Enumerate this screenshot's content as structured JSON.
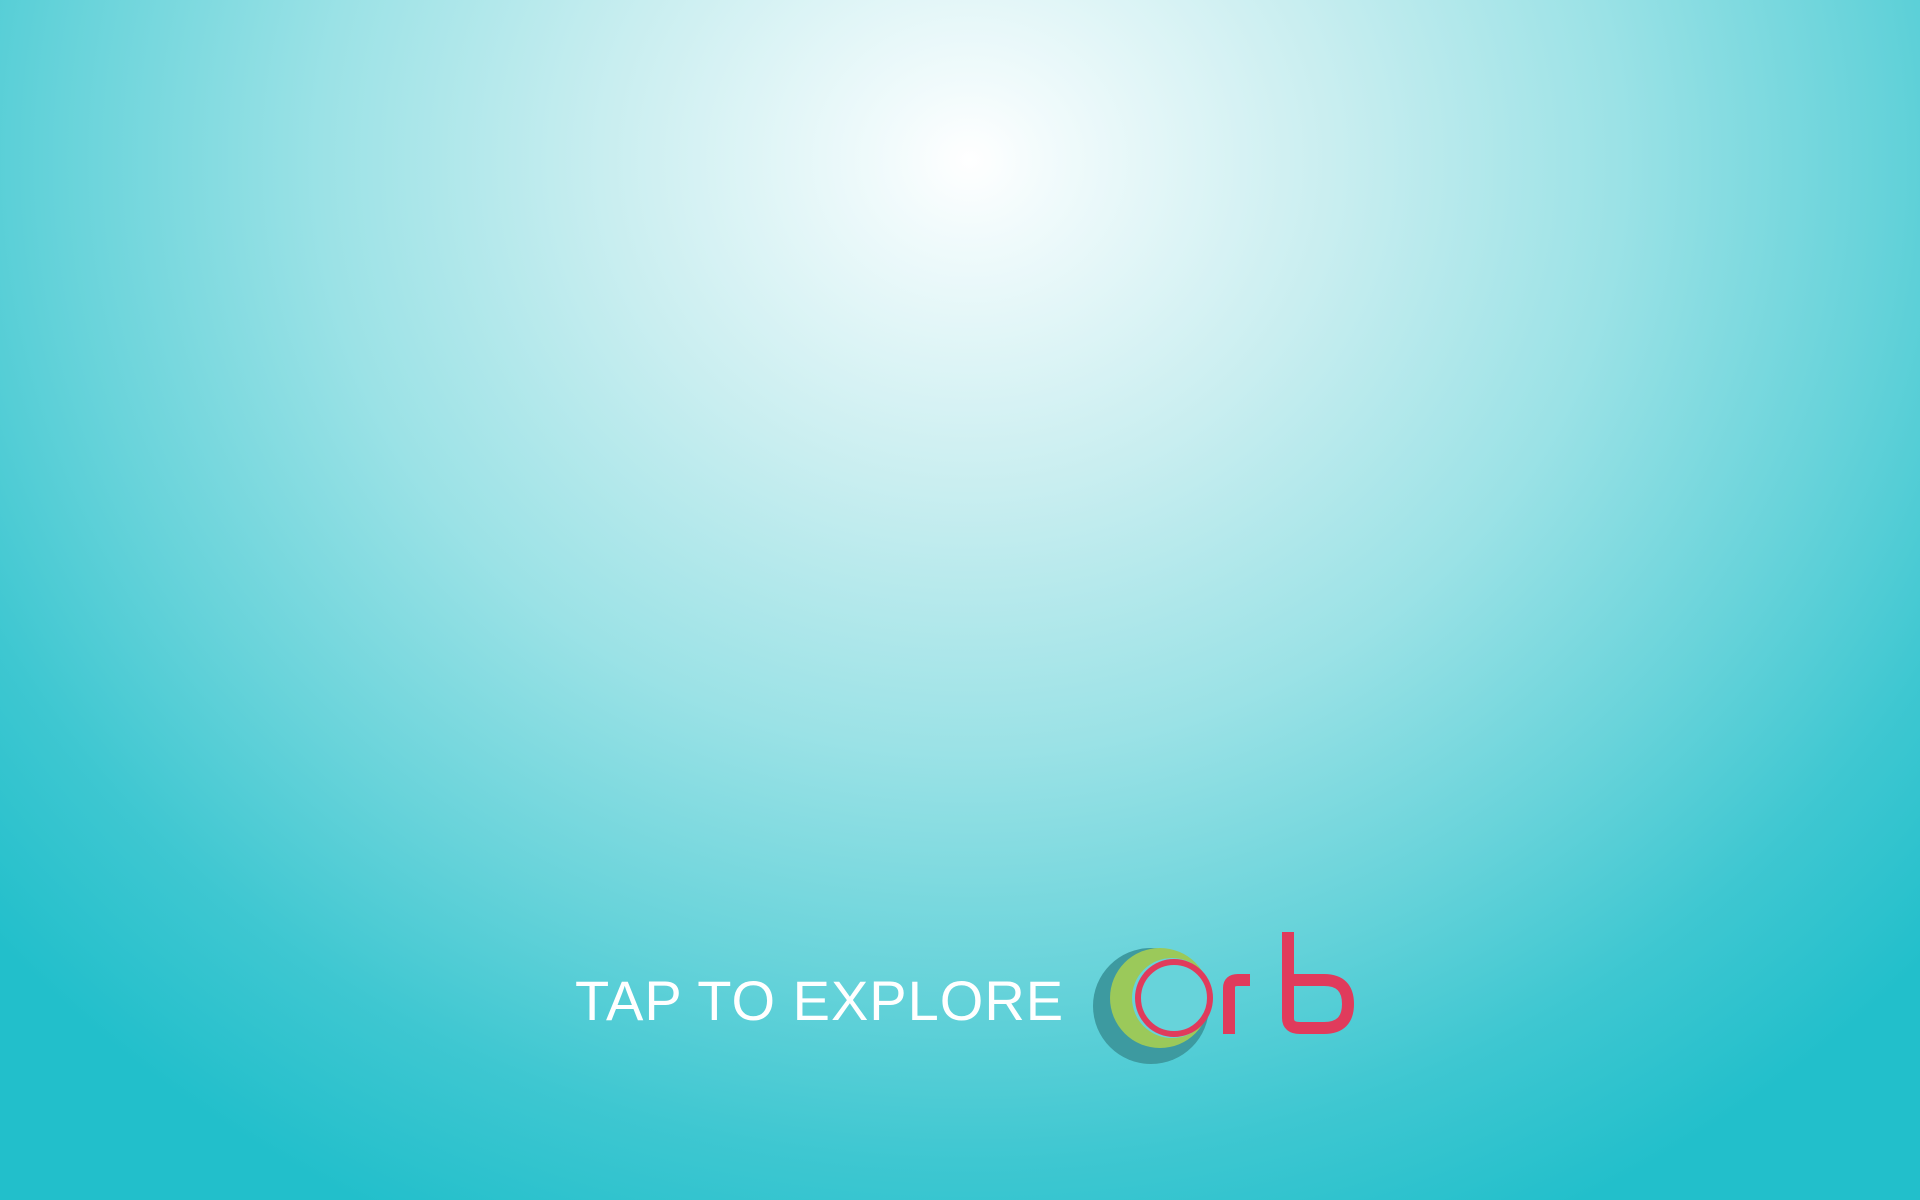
{
  "cta": {
    "label": "TAP TO EXPLORE"
  },
  "logo": {
    "text": "orb",
    "colors": {
      "ring_shadow": "#3d9aa0",
      "ring_green": "#9bc95a",
      "ring_red": "#e03b5c",
      "letters": "#e03b5c"
    }
  },
  "background": {
    "center_color": "#ffffff",
    "edge_color": "#22bfcb"
  }
}
